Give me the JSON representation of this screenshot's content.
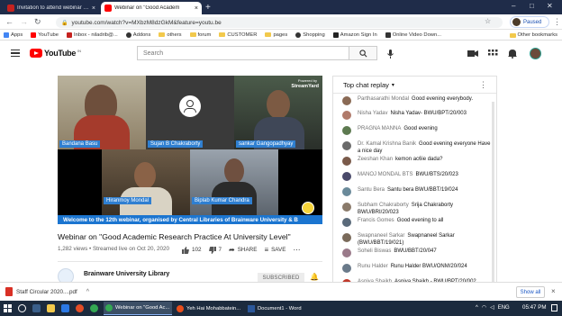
{
  "browser": {
    "tabs": [
      {
        "title": "Invitation to attend webinar on",
        "active": false
      },
      {
        "title": "Webinar on \"Good Academ",
        "active": true
      }
    ],
    "new_tab_symbol": "+",
    "url": "youtube.com/watch?v=MXbzM8dzGkM&feature=youtu.be",
    "profile_label": "Paused",
    "bookmarks": [
      "Apps",
      "YouTube",
      "Inbox - niladrib@...",
      "Addons",
      "others",
      "forum",
      "CUSTOMER",
      "pages",
      "Shopping",
      "Amazon Sign In",
      "Online Video Down..."
    ],
    "other_bookmarks": "Other bookmarks"
  },
  "youtube": {
    "logo_text": "YouTube",
    "logo_region": "IN",
    "search_placeholder": "Search"
  },
  "video": {
    "participants": [
      "Bandana Basu",
      "Sujan B Chakraborty",
      "sankar Gangopadhyay",
      "Hiranmoy Mondal",
      "Biplab Kumar Chandra"
    ],
    "powered_by": "Powered by",
    "streamyard": "StreamYard",
    "banner": "Welcome to the 12th webinar, organised by Central Libraries of Brainware University & B",
    "title": "Webinar on \"Good Academic Research Practice At University Level\"",
    "meta": "1,282 views • Streamed live on Oct 20, 2020",
    "likes": "102",
    "dislikes": "7",
    "share": "SHARE",
    "save": "SAVE",
    "channel": "Brainware University Library",
    "subscribe": "SUBSCRIBED"
  },
  "chat": {
    "header": "Top chat replay",
    "messages": [
      {
        "author": "Parthasarathi Mondal",
        "text": "Good evening everybody.",
        "color": "#8a6a55"
      },
      {
        "author": "Nisha Yadav",
        "text": "Nisha Yadav- BWU/BPT/20/003",
        "color": "#b07a6a"
      },
      {
        "author": "PRAGNA MANNA",
        "text": "Good evening",
        "color": "#5d7a50"
      },
      {
        "author": "Dr. Kamal Krishna Banik",
        "text": "Good evening everyone Have a nice day",
        "color": "#6a6a6a"
      },
      {
        "author": "Zeeshan Khan",
        "text": "kemon ac6ie dada?",
        "color": "#7a5a4a"
      },
      {
        "author": "MANOJ MONDAL BTS",
        "text": "BWU/BTS/20/023",
        "color": "#4a4a6a"
      },
      {
        "author": "Santu Bera",
        "text": "Santu bera BWU/BBT/19/024",
        "color": "#6a8a9a"
      },
      {
        "author": "Subham Chakraborty",
        "text": "Srija Chakraborty BWU/BRI/20/023",
        "color": "#8a7a6a"
      },
      {
        "author": "Francis Gomes",
        "text": "Good evening to all",
        "color": "#5a6a7a"
      },
      {
        "author": "Swapnaneel Sarkar",
        "text": "Swapnaneel Sarkar (BWU/BBT/19/021)",
        "color": "#7a6a5a"
      },
      {
        "author": "Soheli Biswas",
        "text": "BWU/BBT/20/047",
        "color": "#9a7a8a"
      },
      {
        "author": "Runu Halder",
        "text": "Runu Halder BWU/ONM/20/024",
        "color": "#6a7a8a"
      },
      {
        "author": "Aspiya Shaikh",
        "text": "Aspiya Shaikh - BWU/BPT/20/002",
        "color": "#c0392b"
      }
    ]
  },
  "downloads": {
    "file": "Staff Circular 2020....pdf",
    "show_all": "Show all"
  },
  "taskbar": {
    "apps": [
      "Webinar on \"Good Ac...",
      "Yeh Hai Mohabbatein...",
      "Document1 - Word"
    ],
    "lang": "ENG",
    "time": "05:47 PM"
  }
}
